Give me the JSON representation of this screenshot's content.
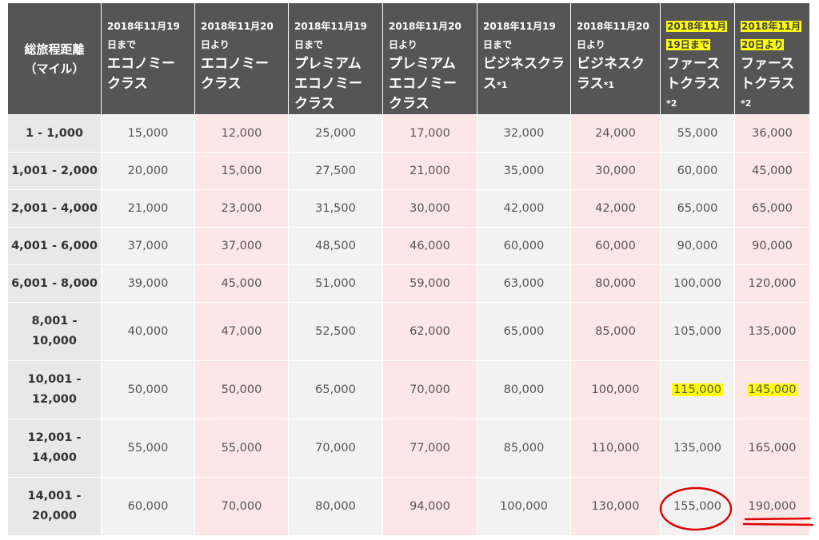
{
  "table": {
    "corner_header": [
      "総旅程距離",
      "（マイル）"
    ],
    "columns": [
      {
        "date": "2018年11月19",
        "date2": "日まで",
        "class_name": [
          "エコノミー",
          "クラス"
        ],
        "note": ""
      },
      {
        "date": "2018年11月20",
        "date2": "日より",
        "class_name": [
          "エコノミー",
          "クラス"
        ],
        "note": ""
      },
      {
        "date": "2018年11月19",
        "date2": "日まで",
        "class_name": [
          "プレミアム",
          "エコノミー",
          "クラス"
        ],
        "note": ""
      },
      {
        "date": "2018年11月20",
        "date2": "日より",
        "class_name": [
          "プレミアム",
          "エコノミー",
          "クラス"
        ],
        "note": ""
      },
      {
        "date": "2018年11月19",
        "date2": "日まで",
        "class_name": [
          "ビジネスクラ",
          "ス"
        ],
        "note": "*1"
      },
      {
        "date": "2018年11月20",
        "date2": "日より",
        "class_name": [
          "ビジネスク",
          "ラス"
        ],
        "note": "*1"
      },
      {
        "date": "2018年11月",
        "date2": "19日まで",
        "class_name": [
          "ファース",
          "トクラス"
        ],
        "note": "*2"
      },
      {
        "date": "2018年11月",
        "date2": "20日より",
        "class_name": [
          "ファース",
          "トクラス"
        ],
        "note": "*2"
      }
    ],
    "rows": [
      {
        "range": [
          "1 - 1,000"
        ],
        "values": [
          "15,000",
          "12,000",
          "25,000",
          "17,000",
          "32,000",
          "24,000",
          "55,000",
          "36,000"
        ]
      },
      {
        "range": [
          "1,001 - 2,000"
        ],
        "values": [
          "20,000",
          "15,000",
          "27,500",
          "21,000",
          "35,000",
          "30,000",
          "60,000",
          "45,000"
        ]
      },
      {
        "range": [
          "2,001 - 4,000"
        ],
        "values": [
          "21,000",
          "23,000",
          "31,500",
          "30,000",
          "42,000",
          "42,000",
          "65,000",
          "65,000"
        ]
      },
      {
        "range": [
          "4,001 - 6,000"
        ],
        "values": [
          "37,000",
          "37,000",
          "48,500",
          "46,000",
          "60,000",
          "60,000",
          "90,000",
          "90,000"
        ]
      },
      {
        "range": [
          "6,001 - 8,000"
        ],
        "values": [
          "39,000",
          "45,000",
          "51,000",
          "59,000",
          "63,000",
          "80,000",
          "100,000",
          "120,000"
        ]
      },
      {
        "range": [
          "8,001 -",
          "10,000"
        ],
        "values": [
          "40,000",
          "47,000",
          "52,500",
          "62,000",
          "65,000",
          "85,000",
          "105,000",
          "135,000"
        ]
      },
      {
        "range": [
          "10,001 -",
          "12,000"
        ],
        "values": [
          "50,000",
          "50,000",
          "65,000",
          "70,000",
          "80,000",
          "100,000",
          "115,000",
          "145,000"
        ]
      },
      {
        "range": [
          "12,001 -",
          "14,000"
        ],
        "values": [
          "55,000",
          "55,000",
          "70,000",
          "77,000",
          "85,000",
          "110,000",
          "135,000",
          "165,000"
        ]
      },
      {
        "range": [
          "14,001 -",
          "20,000"
        ],
        "values": [
          "60,000",
          "70,000",
          "80,000",
          "94,000",
          "100,000",
          "130,000",
          "155,000",
          "190,000"
        ]
      }
    ]
  },
  "colors": {
    "header_bg": "#555555",
    "header_text": "#ffffff",
    "range_bg": "#e8e8e8",
    "cell_bg_even": "#f2f2f2",
    "cell_bg_odd": "#fde6e6",
    "highlight": "#ffff00",
    "annotation": "#e00000"
  },
  "annotations": {
    "highlighted_header_columns": [
      7,
      8
    ],
    "highlighted_cells": [
      {
        "row": 7,
        "column": 7
      },
      {
        "row": 7,
        "column": 8
      }
    ],
    "circled_cell": {
      "row": 9,
      "column": 7
    },
    "underlined_cell": {
      "row": 9,
      "column": 8
    }
  }
}
